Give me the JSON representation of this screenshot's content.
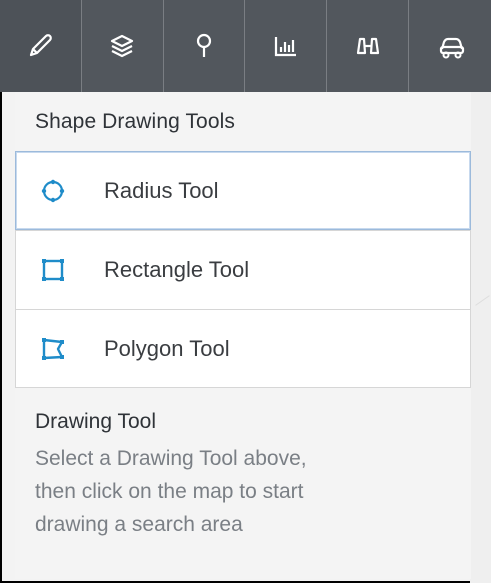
{
  "toolbar": {
    "tabs": [
      {
        "name": "tab-draw",
        "icon": "pencil-icon"
      },
      {
        "name": "tab-layers",
        "icon": "layers-icon"
      },
      {
        "name": "tab-location",
        "icon": "location-pin-icon"
      },
      {
        "name": "tab-stats",
        "icon": "bar-chart-icon"
      },
      {
        "name": "tab-search",
        "icon": "binoculars-icon"
      },
      {
        "name": "tab-vehicle",
        "icon": "car-icon"
      }
    ]
  },
  "panel": {
    "header": "Shape Drawing Tools",
    "tools": [
      {
        "label": "Radius Tool",
        "icon": "radius-icon"
      },
      {
        "label": "Rectangle Tool",
        "icon": "rectangle-icon"
      },
      {
        "label": "Polygon Tool",
        "icon": "polygon-icon"
      }
    ],
    "help": {
      "title": "Drawing Tool",
      "text_line1": "Select a Drawing Tool above,",
      "text_line2": "then click on the map to start",
      "text_line3": "drawing a search area"
    }
  },
  "colors": {
    "toolbar_bg": "#52575d",
    "panel_bg": "#f4f4f4",
    "accent_blue": "#1f8cc9",
    "selected_border": "#9cbadb"
  }
}
